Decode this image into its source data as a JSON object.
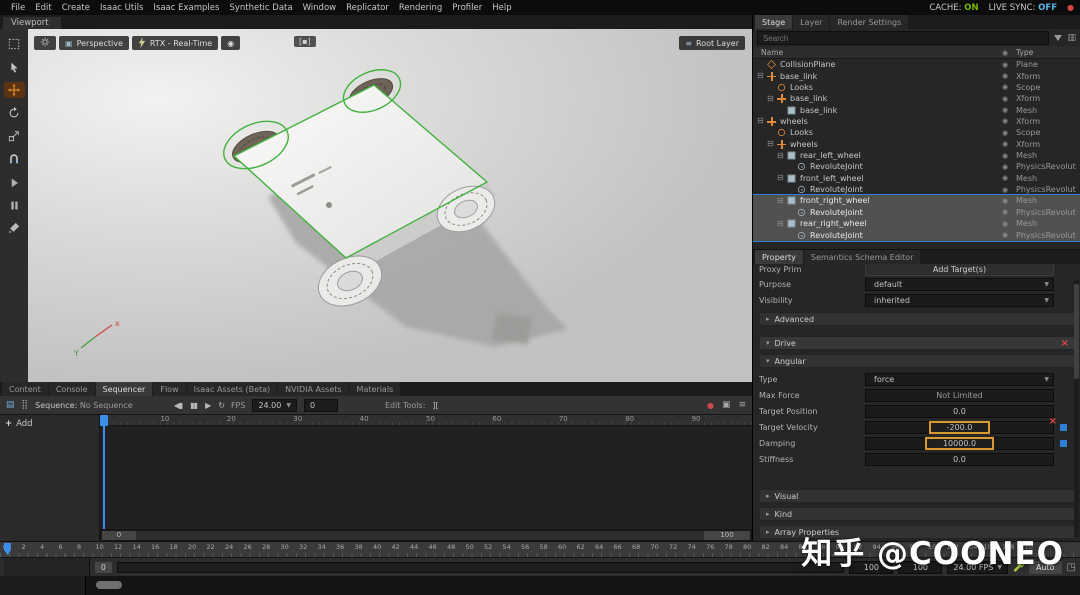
{
  "menubar": {
    "items": [
      "File",
      "Edit",
      "Create",
      "Isaac Utils",
      "Isaac Examples",
      "Synthetic Data",
      "Window",
      "Replicator",
      "Rendering",
      "Profiler",
      "Help"
    ],
    "cache_label": "CACHE:",
    "cache_value": "ON",
    "live_sync_label": "LIVE SYNC:",
    "live_sync_value": "OFF"
  },
  "viewport": {
    "tab_label": "Viewport",
    "camera_button": "Perspective",
    "renderer_button": "RTX - Real-Time",
    "root_layer_button": "Root Layer",
    "axis_x_label": "x",
    "axis_y_label": "Y"
  },
  "stage": {
    "tabs": [
      "Stage",
      "Layer",
      "Render Settings"
    ],
    "search_placeholder": "Search",
    "name_column": "Name",
    "type_column": "Type",
    "rows": [
      {
        "name": "CollisionPlane",
        "type": "Plane"
      },
      {
        "name": "base_link",
        "type": "Xform"
      },
      {
        "name": "Looks",
        "type": "Scope"
      },
      {
        "name": "base_link",
        "type": "Xform"
      },
      {
        "name": "base_link",
        "type": "Mesh"
      },
      {
        "name": "wheels",
        "type": "Xform"
      },
      {
        "name": "Looks",
        "type": "Scope"
      },
      {
        "name": "wheels",
        "type": "Xform"
      },
      {
        "name": "rear_left_wheel",
        "type": "Mesh"
      },
      {
        "name": "RevoluteJoint",
        "type": "PhysicsRevolute."
      },
      {
        "name": "front_left_wheel",
        "type": "Mesh"
      },
      {
        "name": "RevoluteJoint",
        "type": "PhysicsRevolute."
      },
      {
        "name": "front_right_wheel",
        "type": "Mesh"
      },
      {
        "name": "RevoluteJoint",
        "type": "PhysicsRevolute."
      },
      {
        "name": "rear_right_wheel",
        "type": "Mesh"
      },
      {
        "name": "RevoluteJoint",
        "type": "PhysicsRevolute."
      }
    ]
  },
  "properties": {
    "tabs": [
      "Property",
      "Semantics Schema Editor"
    ],
    "proxy_prim_label": "Proxy Prim",
    "add_targets_button": "Add Target(s)",
    "purpose_label": "Purpose",
    "purpose_value": "default",
    "visibility_label": "Visibility",
    "visibility_value": "inherited",
    "advanced_section": "Advanced",
    "drive_section": "Drive",
    "angular_section": "Angular",
    "type_label": "Type",
    "type_value": "force",
    "max_force_label": "Max Force",
    "max_force_value": "Not Limited",
    "target_position_label": "Target Position",
    "target_position_value": "0.0",
    "target_velocity_label": "Target Velocity",
    "target_velocity_value": "-200.0",
    "damping_label": "Damping",
    "damping_value": "10000.0",
    "stiffness_label": "Stiffness",
    "stiffness_value": "0.0",
    "visual_section": "Visual",
    "kind_section": "Kind",
    "array_section": "Array Properties"
  },
  "bottom_tabs": [
    "Content",
    "Console",
    "Sequencer",
    "Flow",
    "Isaac Assets (Beta)",
    "NVIDIA Assets",
    "Materials"
  ],
  "sequencer": {
    "sequence_label": "Sequence:",
    "sequence_value": "No Sequence",
    "fps_label": "FPS",
    "fps_value": "24.00",
    "frame_field": "0",
    "edit_tools_label": "Edit Tools:",
    "add_button": "Add",
    "ruler_numbers": [
      "10",
      "20",
      "30",
      "40",
      "50",
      "60",
      "70",
      "80",
      "90"
    ],
    "range_start": "0",
    "range_end": "100"
  },
  "timeline": {
    "ruler_numbers": [
      "0",
      "2",
      "4",
      "6",
      "8",
      "10",
      "12",
      "14",
      "16",
      "18",
      "20",
      "22",
      "24",
      "26",
      "28",
      "30",
      "32",
      "34",
      "36",
      "38",
      "40",
      "42",
      "44",
      "46",
      "48",
      "50",
      "52",
      "54",
      "56",
      "58",
      "60",
      "62",
      "64",
      "66",
      "68",
      "70",
      "72",
      "74",
      "76",
      "78",
      "80",
      "82",
      "84",
      "86",
      "88",
      "90",
      "92",
      "94",
      "96",
      "98",
      "100",
      "102",
      "104",
      "106",
      "108",
      "110"
    ],
    "start_handle": "0",
    "end_field": "100",
    "range_end_field": "100",
    "fps_dropdown": "24.00 FPS",
    "auto_label": "Auto"
  },
  "icons": {
    "record": "●",
    "eye": "◉",
    "caret": "▼",
    "tri_collapsed": "▸",
    "tri_expanded": "▾",
    "expander_minus": "⊟",
    "hamburger": "≡",
    "camera": "▣",
    "sequencer": "▤",
    "dots_grid": "⣿",
    "loop": "↻",
    "play": "▶",
    "pause": "▮▮",
    "skip_start": "◀▮",
    "close": "×",
    "edit_brackets": "][",
    "plus": "+",
    "expand": "◳",
    "columns": "▥",
    "hud": "[▪]"
  },
  "watermark": "知乎 @COONEO"
}
